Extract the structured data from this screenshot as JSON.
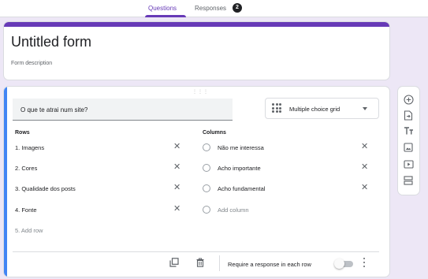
{
  "tabs": {
    "questions_label": "Questions",
    "responses_label": "Responses",
    "responses_count": "2"
  },
  "form": {
    "title": "Untitled form",
    "description": "Form description"
  },
  "question": {
    "text": "O que te atrai num site?",
    "type_label": "Multiple choice grid",
    "rows_header": "Rows",
    "columns_header": "Columns",
    "rows": [
      "1.  Imagens",
      "2.  Cores",
      "3.  Qualidade dos posts",
      "4.  Fonte"
    ],
    "add_row": "5.  Add row",
    "columns": [
      "Não me interessa",
      "Acho importante",
      "Acho fundamental"
    ],
    "add_column": "Add column",
    "require_label": "Require a response in each row",
    "required": false
  },
  "toolbar": {
    "icons": [
      "add-question-icon",
      "import-questions-icon",
      "add-title-icon",
      "add-image-icon",
      "add-video-icon",
      "add-section-icon"
    ]
  },
  "colors": {
    "accent": "#673ab7",
    "focus": "#4285f4",
    "background": "#ede7f6"
  }
}
